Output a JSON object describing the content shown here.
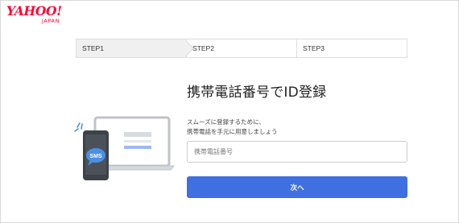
{
  "logo": {
    "word": "YAHOO!",
    "sub": "JAPAN"
  },
  "steps": [
    {
      "label": "STEP1",
      "active": true
    },
    {
      "label": "STEP2",
      "active": false
    },
    {
      "label": "STEP3",
      "active": false
    }
  ],
  "page": {
    "title": "携帯電話番号でID登録",
    "description_line1": "スムーズに登録するために、",
    "description_line2": "携帯電話を手元に用意しましょう"
  },
  "form": {
    "phone_placeholder": "携帯電話番号",
    "phone_value": "",
    "next_label": "次へ"
  },
  "illustration": {
    "bubble_text": "SMS"
  },
  "colors": {
    "brand": "#ff0033",
    "primary_button": "#3f6fe0",
    "illustration_blue": "#4a90e2"
  }
}
